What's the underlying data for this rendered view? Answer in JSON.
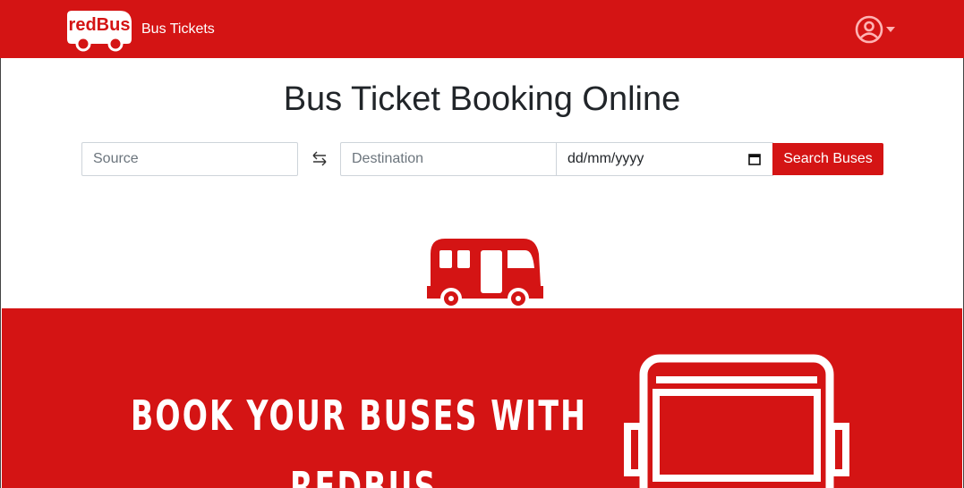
{
  "header": {
    "logo_text": "redBus",
    "brand_label": "Bus Tickets",
    "account_icon": "user-circle-icon",
    "dropdown_icon": "caret-down-icon",
    "bg_color": "#d41414"
  },
  "search": {
    "title": "Bus Ticket Booking Online",
    "source_placeholder": "Source",
    "destination_placeholder": "Destination",
    "date_value": "dd/mm/yyyy",
    "swap_icon": "swap-arrows-icon",
    "calendar_icon": "calendar-icon",
    "button_label": "Search Buses"
  },
  "banner": {
    "line1": "BOOK YOUR BUSES WITH",
    "line2": "REDBUS",
    "bus_icon": "bus-front-icon",
    "accent": "#d41414"
  }
}
